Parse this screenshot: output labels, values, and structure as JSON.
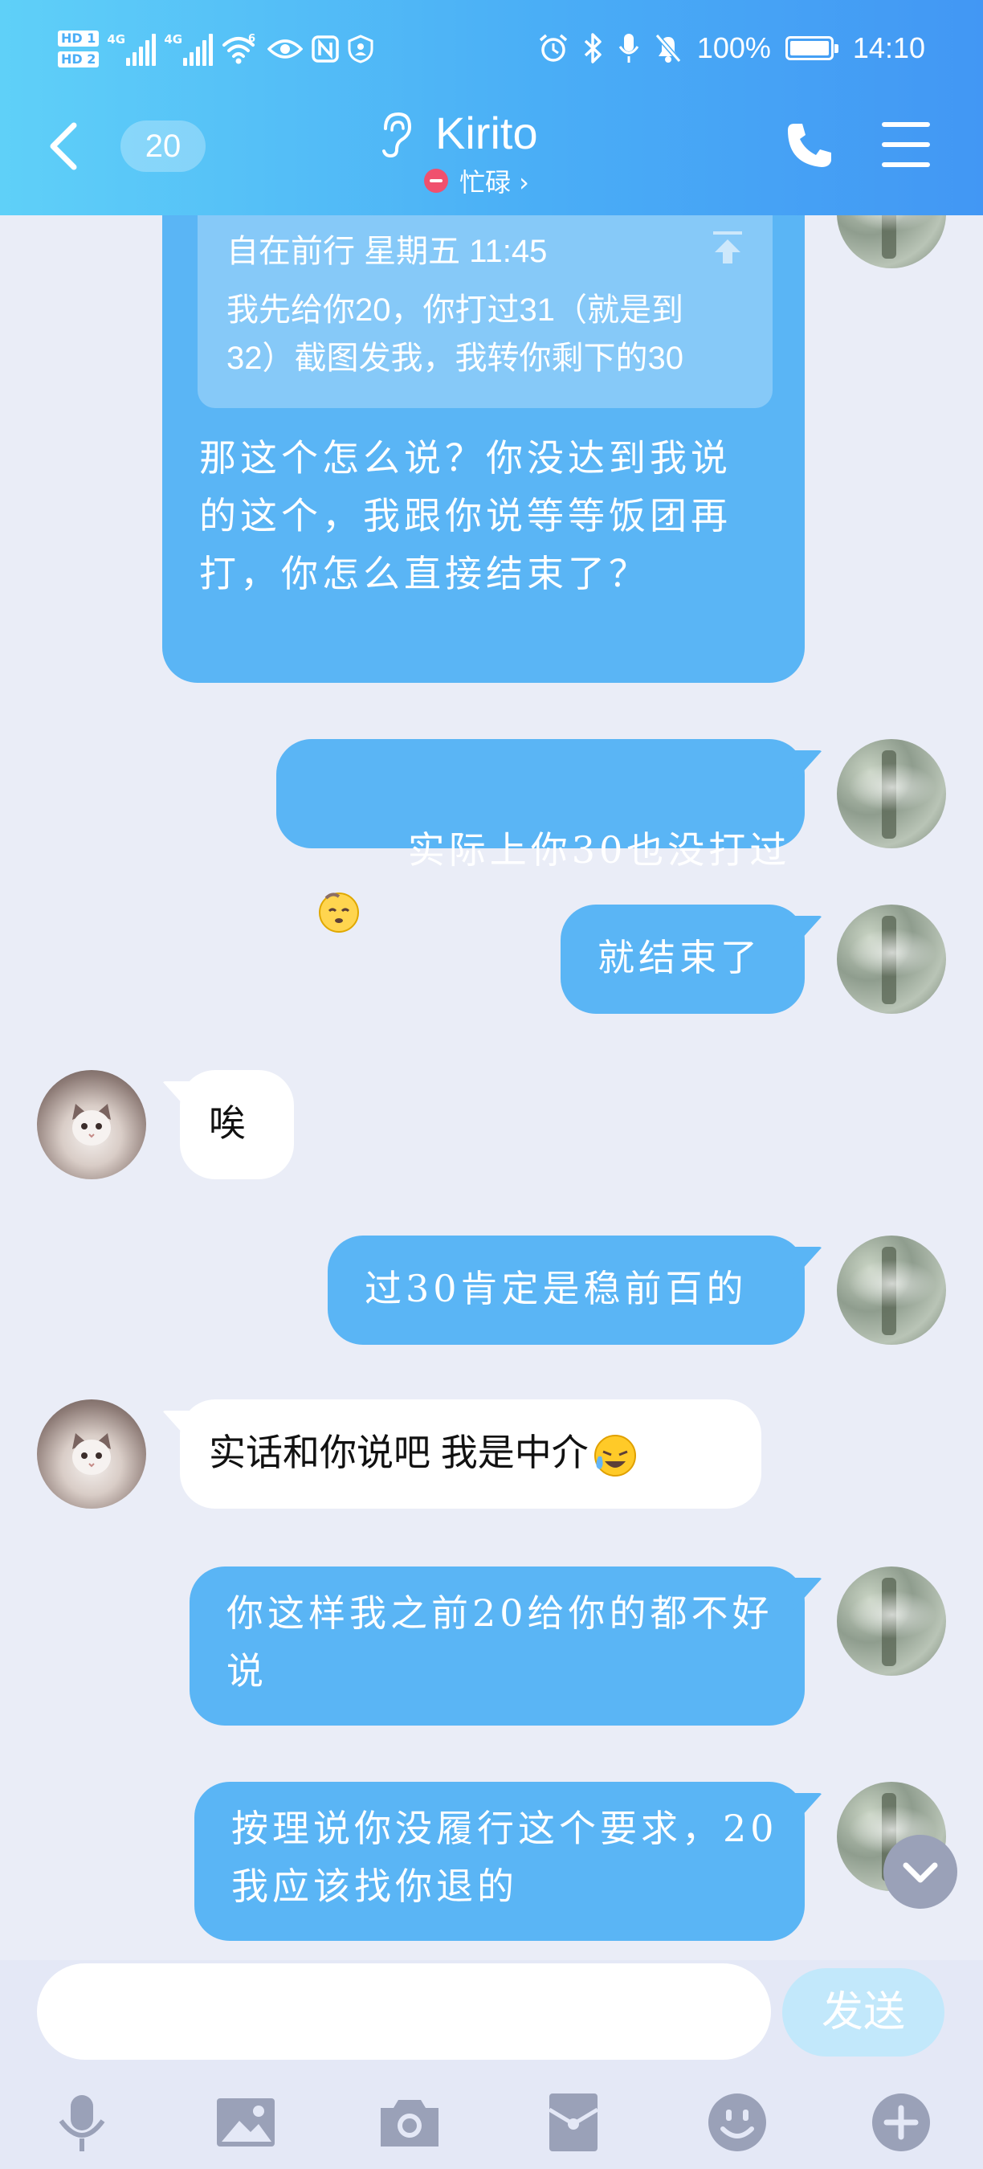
{
  "status_bar": {
    "sim1": "HD 1",
    "sim2": "HD 2",
    "net1": "4G",
    "net2": "4G",
    "wifi_label": "6",
    "battery": "100%",
    "time": "14:10",
    "icons": [
      "alarm-icon",
      "bluetooth-icon",
      "mic-icon",
      "mute-icon",
      "battery-icon"
    ]
  },
  "header": {
    "unread_count": "20",
    "contact_name": "Kirito",
    "presence": "忙碌 ›",
    "presence_color": "#f0506e",
    "gradient": [
      "#5fd0f8",
      "#4297f4"
    ]
  },
  "messages": [
    {
      "dir": "out",
      "quote": {
        "author_time": "自在前行 星期五 11:45",
        "text": "我先给你20，你打过31（就是到32）截图发我，我转你剩下的30"
      },
      "text": "那这个怎么说？你没达到我说的这个，我跟你说等等饭团再打，你怎么直接结束了？"
    },
    {
      "dir": "out",
      "text": "实际上你30也没打过",
      "emoji": "smug-face-emoji"
    },
    {
      "dir": "out",
      "text": "就结束了"
    },
    {
      "dir": "in",
      "text": "唉"
    },
    {
      "dir": "out",
      "text": "过30肯定是稳前百的"
    },
    {
      "dir": "in",
      "text": "实话和你说吧 我是中介",
      "emoji": "crying-laughing-emoji"
    },
    {
      "dir": "out",
      "text": "你这样我之前20给你的都不好说"
    },
    {
      "dir": "out",
      "text": "按理说你没履行这个要求，20我应该找你退的"
    }
  ],
  "composer": {
    "input_value": "",
    "send_label": "发送",
    "tools": [
      "mic-icon",
      "image-icon",
      "camera-icon",
      "red-packet-icon",
      "emoji-icon",
      "plus-icon"
    ]
  },
  "colors": {
    "outgoing_bubble": "#5ab5f5",
    "incoming_bubble": "#ffffff",
    "chat_background": "#eaedf7"
  }
}
